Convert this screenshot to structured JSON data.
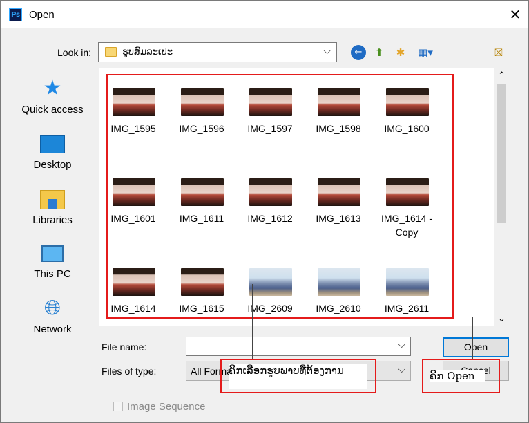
{
  "window": {
    "title": "Open",
    "app_icon": "Ps"
  },
  "toolbar": {
    "look_in_label": "Look in:",
    "look_in_value": "ຮູບສົມລະເປະ",
    "icons": [
      "back-icon",
      "up-folder-icon",
      "new-folder-icon",
      "view-menu-icon",
      "desktop-folder-icon"
    ]
  },
  "places": [
    {
      "label": "Quick access",
      "icon": "star-icon"
    },
    {
      "label": "Desktop",
      "icon": "desktop-icon"
    },
    {
      "label": "Libraries",
      "icon": "libraries-icon"
    },
    {
      "label": "This PC",
      "icon": "computer-icon"
    },
    {
      "label": "Network",
      "icon": "network-icon"
    }
  ],
  "files": [
    {
      "name": "IMG_1595",
      "thumb": "dark"
    },
    {
      "name": "IMG_1596",
      "thumb": "dark"
    },
    {
      "name": "IMG_1597",
      "thumb": "dark"
    },
    {
      "name": "IMG_1598",
      "thumb": "dark"
    },
    {
      "name": "IMG_1600",
      "thumb": "dark"
    },
    {
      "name": "IMG_1601",
      "thumb": "dark"
    },
    {
      "name": "IMG_1611",
      "thumb": "dark"
    },
    {
      "name": "IMG_1612",
      "thumb": "dark"
    },
    {
      "name": "IMG_1613",
      "thumb": "dark"
    },
    {
      "name": "IMG_1614 - Copy",
      "thumb": "dark"
    },
    {
      "name": "IMG_1614",
      "thumb": "dark"
    },
    {
      "name": "IMG_1615",
      "thumb": "dark"
    },
    {
      "name": "IMG_2609",
      "thumb": "light"
    },
    {
      "name": "IMG_2610",
      "thumb": "light"
    },
    {
      "name": "IMG_2611",
      "thumb": "light"
    }
  ],
  "form": {
    "file_name_label": "File name:",
    "file_name_value": "",
    "files_of_type_label": "Files of type:",
    "files_of_type_value": "All Formats"
  },
  "buttons": {
    "open": "Open",
    "cancel": "Cancel"
  },
  "image_sequence": {
    "label": "Image Sequence",
    "checked": false
  },
  "annotations": {
    "select_images": "ຄິກເລືອກຮູບພາບທີ່ຕ້ອງການ",
    "click_open": "ຄິກ Open"
  },
  "colors": {
    "annotation_border": "#e41b1b",
    "default_button_border": "#0078d7"
  }
}
